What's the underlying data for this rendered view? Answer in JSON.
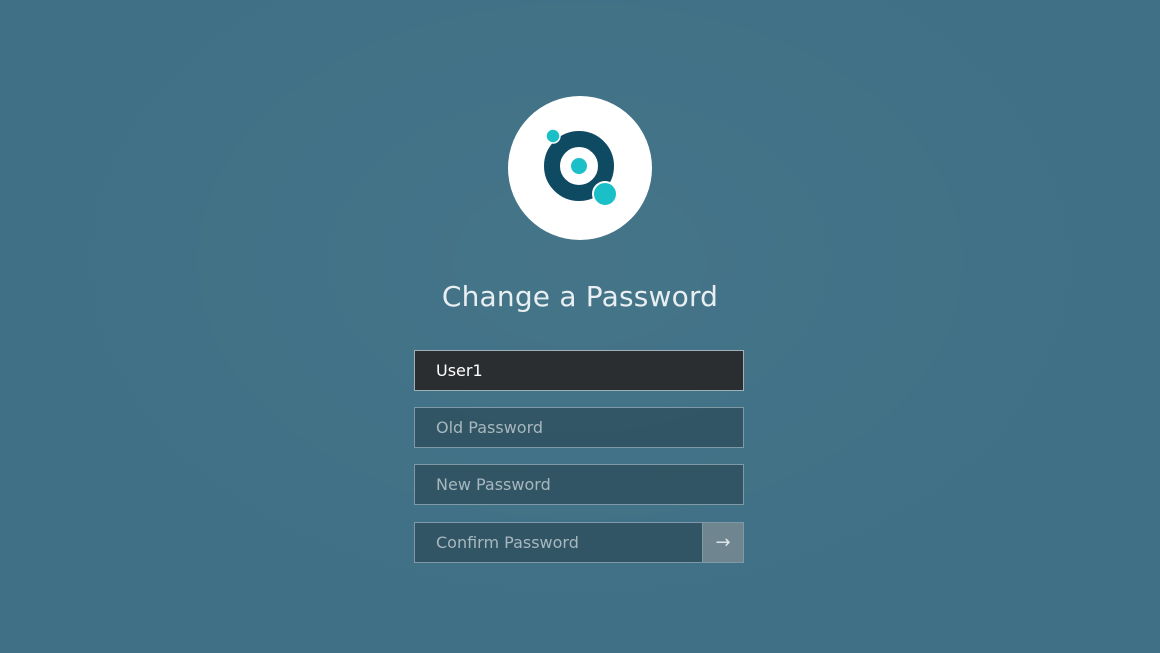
{
  "page": {
    "title": "Change a Password"
  },
  "logo": {
    "icon": "orbit-logo-icon",
    "colors": {
      "ring": "#0f4a63",
      "accent": "#1bbfc7",
      "background": "#ffffff"
    }
  },
  "form": {
    "username": {
      "value": "User1",
      "placeholder": ""
    },
    "old_password": {
      "value": "",
      "placeholder": "Old Password"
    },
    "new_password": {
      "value": "",
      "placeholder": "New Password"
    },
    "confirm_password": {
      "value": "",
      "placeholder": "Confirm Password"
    },
    "submit_icon": "arrow-right-icon",
    "submit_glyph": "→"
  },
  "colors": {
    "background": "#3f7085",
    "username_field": "#2b2e31",
    "submit_button": "#6f8690"
  }
}
